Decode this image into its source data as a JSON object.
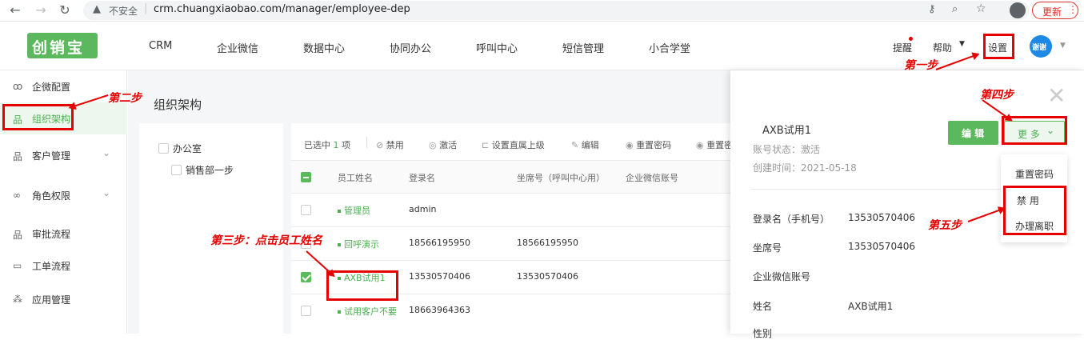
{
  "browser": {
    "security_label": "不安全",
    "url": "crm.chuangxiaobao.com/manager/employee-dep",
    "update_label": "更新"
  },
  "app": {
    "logo": "创销宝",
    "nav": [
      "CRM",
      "企业微信",
      "数据中心",
      "协同办公",
      "呼叫中心",
      "短信管理",
      "小合学堂"
    ],
    "remind_label": "提醒",
    "help_label": "帮助",
    "settings_label": "设置",
    "avatar_label": "谢谢"
  },
  "sidebar": {
    "items": [
      {
        "label": "企微配置"
      },
      {
        "label": "组织架构"
      },
      {
        "label": "客户管理"
      },
      {
        "label": "角色权限"
      },
      {
        "label": "审批流程"
      },
      {
        "label": "工单流程"
      },
      {
        "label": "应用管理"
      }
    ]
  },
  "main": {
    "page_title": "组织架构",
    "tree": [
      "办公室",
      "销售部一步"
    ],
    "toolbar": {
      "selected_prefix": "已选中",
      "selected_count": "1",
      "selected_suffix": "项",
      "actions": [
        "禁用",
        "激活",
        "设置直属上级",
        "编辑",
        "重置密码",
        "重置密"
      ]
    },
    "table": {
      "headers": [
        "员工姓名",
        "登录名",
        "坐席号（呼叫中心用）",
        "企业微信账号"
      ],
      "rows": [
        {
          "name": "管理员",
          "login": "admin",
          "seat": ""
        },
        {
          "name": "回呼演示",
          "login": "18566195950",
          "seat": "18566195950"
        },
        {
          "name": "AXB试用1",
          "login": "13530570406",
          "seat": "13530570406"
        },
        {
          "name": "试用客户不要",
          "login": "18663964363",
          "seat": ""
        }
      ]
    }
  },
  "drawer": {
    "name": "AXB试用1",
    "status_label": "账号状态：",
    "status_value": "激活",
    "created_label": "创建时间：",
    "created_value": "2021-05-18",
    "edit_label": "编 辑",
    "more_label": "更 多",
    "menu": [
      "重置密码",
      "禁 用",
      "办理离职"
    ],
    "fields": [
      {
        "label": "登录名（手机号）",
        "value": "13530570406"
      },
      {
        "label": "坐席号",
        "value": "13530570406"
      },
      {
        "label": "企业微信账号",
        "value": ""
      },
      {
        "label": "姓名",
        "value": "AXB试用1"
      },
      {
        "label": "性别",
        "value": ""
      }
    ]
  },
  "annotations": {
    "step1": "第一步",
    "step2": "第二步",
    "step3": "第三步：点击员工姓名",
    "step4": "第四步",
    "step5": "第五步"
  },
  "colors": {
    "brand": "#5cb85c",
    "annotation": "#e60000"
  }
}
